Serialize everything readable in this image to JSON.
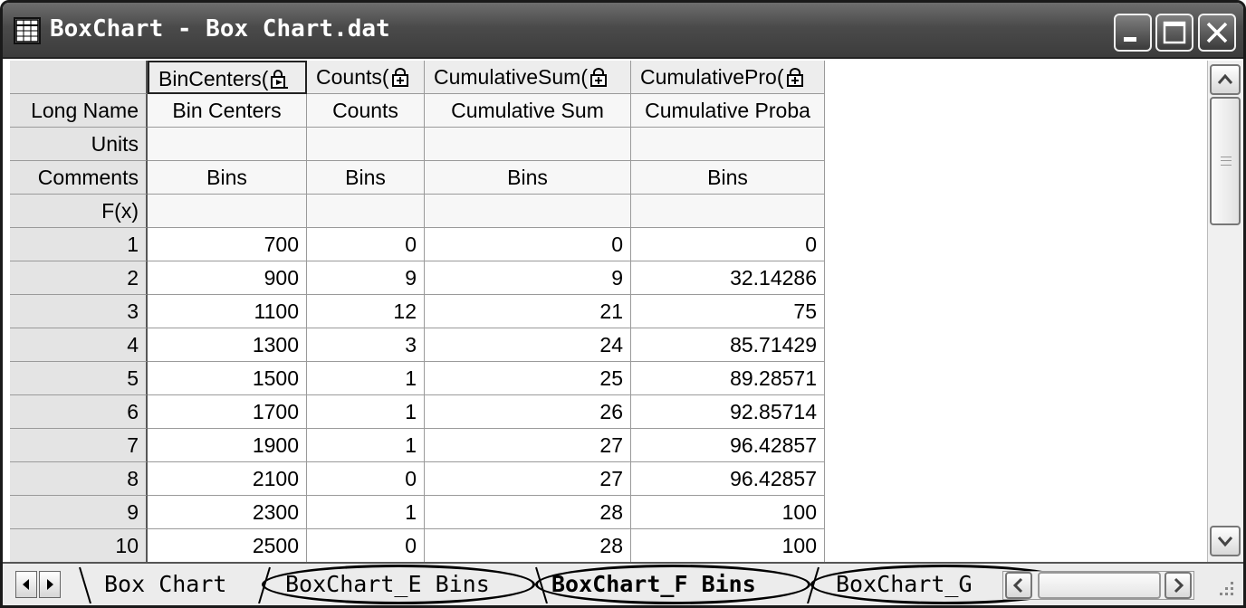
{
  "window": {
    "title": "BoxChart - Box Chart.dat",
    "controls": [
      "minimize",
      "maximize",
      "close"
    ]
  },
  "columns": [
    {
      "header": "BinCenters(",
      "header_icon": "calculator-lock-icon"
    },
    {
      "header": "Counts(",
      "header_icon": "lock-plus-icon"
    },
    {
      "header": "CumulativeSum(",
      "header_icon": "lock-plus-icon"
    },
    {
      "header": "CumulativePro(",
      "header_icon": "lock-plus-icon"
    }
  ],
  "meta_rows": [
    {
      "label": "Long Name",
      "values": [
        "Bin Centers",
        "Counts",
        "Cumulative Sum",
        "Cumulative Proba"
      ]
    },
    {
      "label": "Units",
      "values": [
        "",
        "",
        "",
        ""
      ]
    },
    {
      "label": "Comments",
      "values": [
        "Bins",
        "Bins",
        "Bins",
        "Bins"
      ]
    },
    {
      "label": "F(x)",
      "values": [
        "",
        "",
        "",
        ""
      ]
    }
  ],
  "rows": [
    {
      "n": "1",
      "values": [
        "700",
        "0",
        "0",
        "0"
      ]
    },
    {
      "n": "2",
      "values": [
        "900",
        "9",
        "9",
        "32.14286"
      ]
    },
    {
      "n": "3",
      "values": [
        "1100",
        "12",
        "21",
        "75"
      ]
    },
    {
      "n": "4",
      "values": [
        "1300",
        "3",
        "24",
        "85.71429"
      ]
    },
    {
      "n": "5",
      "values": [
        "1500",
        "1",
        "25",
        "89.28571"
      ]
    },
    {
      "n": "6",
      "values": [
        "1700",
        "1",
        "26",
        "92.85714"
      ]
    },
    {
      "n": "7",
      "values": [
        "1900",
        "1",
        "27",
        "96.42857"
      ]
    },
    {
      "n": "8",
      "values": [
        "2100",
        "0",
        "27",
        "96.42857"
      ]
    },
    {
      "n": "9",
      "values": [
        "2300",
        "1",
        "28",
        "100"
      ]
    },
    {
      "n": "10",
      "values": [
        "2500",
        "0",
        "28",
        "100"
      ]
    }
  ],
  "tabs": [
    {
      "label": "Box Chart",
      "active": false,
      "circled": false
    },
    {
      "label": "BoxChart_E Bins",
      "active": false,
      "circled": true
    },
    {
      "label": "BoxChart_F Bins",
      "active": true,
      "circled": true
    },
    {
      "label": "BoxChart_G",
      "active": false,
      "circled": true
    }
  ],
  "colors": {
    "title_bar": "#4a4a4a",
    "header_bg": "#e4e4e4",
    "grid_line": "#9a9a9a"
  }
}
